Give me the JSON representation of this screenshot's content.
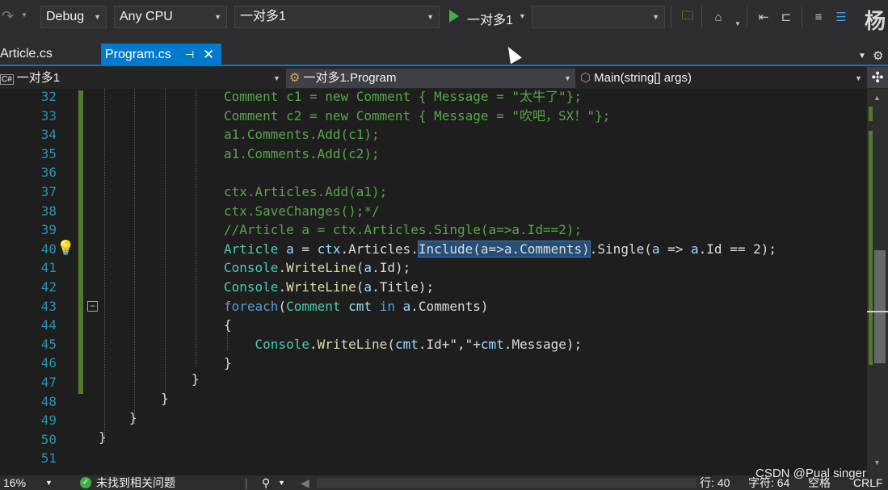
{
  "toolbar": {
    "config": "Debug",
    "platform": "Any CPU",
    "project": "一对多1",
    "run_target": "一对多1",
    "empty_dropdown": "",
    "right_char": "杨",
    "icons": [
      "undo-icon",
      "folder-search-icon",
      "home-icon",
      "step-icon",
      "breakpoint-icon",
      "align-icon",
      "comment-icon"
    ]
  },
  "tabs": [
    {
      "label": "Article.cs",
      "active": false
    },
    {
      "label": "Program.cs",
      "active": true
    }
  ],
  "navbar": {
    "project_icon": "C#",
    "project": "一对多1",
    "class": "一对多1.Program",
    "member": "Main(string[] args)"
  },
  "editor": {
    "line_numbers": [
      "32",
      "33",
      "34",
      "35",
      "36",
      "37",
      "38",
      "39",
      "40",
      "41",
      "42",
      "43",
      "44",
      "45",
      "46",
      "47",
      "48",
      "49",
      "50",
      "51"
    ],
    "lines": [
      [
        {
          "t": "Comment c1 = new Comment { Message = \"太牛了\"};",
          "c": "c-comment"
        }
      ],
      [
        {
          "t": "Comment c2 = new Comment { Message = \"吹吧，SX！\"};",
          "c": "c-comment"
        }
      ],
      [
        {
          "t": "a1.Comments.Add(c1);",
          "c": "c-comment"
        }
      ],
      [
        {
          "t": "a1.Comments.Add(c2);",
          "c": "c-comment"
        }
      ],
      [],
      [
        {
          "t": "ctx.Articles.Add(a1);",
          "c": "c-comment"
        }
      ],
      [
        {
          "t": "ctx.SaveChanges();*/",
          "c": "c-comment"
        }
      ],
      [
        {
          "t": "//Article a = ctx.Articles.Single(a=>a.Id==2);",
          "c": "c-comment"
        }
      ],
      [
        {
          "t": "Article",
          "c": "c-type"
        },
        {
          "t": " ",
          "c": "c-plain"
        },
        {
          "t": "a",
          "c": "c-id"
        },
        {
          "t": " = ",
          "c": "c-plain"
        },
        {
          "t": "ctx",
          "c": "c-id"
        },
        {
          "t": ".Articles.",
          "c": "c-plain"
        },
        {
          "t": "Include(a=>a.Comments)",
          "c": "sel c-plain"
        },
        {
          "t": ".Single(",
          "c": "c-plain"
        },
        {
          "t": "a",
          "c": "c-id"
        },
        {
          "t": " => ",
          "c": "c-plain"
        },
        {
          "t": "a",
          "c": "c-id"
        },
        {
          "t": ".Id == 2);",
          "c": "c-plain"
        }
      ],
      [
        {
          "t": "Console",
          "c": "c-type"
        },
        {
          "t": ".",
          "c": "c-plain"
        },
        {
          "t": "WriteLine",
          "c": "c-method"
        },
        {
          "t": "(",
          "c": "c-plain"
        },
        {
          "t": "a",
          "c": "c-id"
        },
        {
          "t": ".Id);",
          "c": "c-plain"
        }
      ],
      [
        {
          "t": "Console",
          "c": "c-type"
        },
        {
          "t": ".",
          "c": "c-plain"
        },
        {
          "t": "WriteLine",
          "c": "c-method"
        },
        {
          "t": "(",
          "c": "c-plain"
        },
        {
          "t": "a",
          "c": "c-id"
        },
        {
          "t": ".Title);",
          "c": "c-plain"
        }
      ],
      [
        {
          "t": "foreach",
          "c": "c-kw"
        },
        {
          "t": "(",
          "c": "c-plain"
        },
        {
          "t": "Comment",
          "c": "c-type"
        },
        {
          "t": " ",
          "c": "c-plain"
        },
        {
          "t": "cmt",
          "c": "c-id"
        },
        {
          "t": " in ",
          "c": "c-kw"
        },
        {
          "t": "a",
          "c": "c-id"
        },
        {
          "t": ".Comments)",
          "c": "c-plain"
        }
      ],
      [
        {
          "t": "{",
          "c": "c-plain"
        }
      ],
      [
        {
          "t": "    ",
          "c": "c-plain"
        },
        {
          "t": "Console",
          "c": "c-type"
        },
        {
          "t": ".",
          "c": "c-plain"
        },
        {
          "t": "WriteLine",
          "c": "c-method"
        },
        {
          "t": "(",
          "c": "c-plain"
        },
        {
          "t": "cmt",
          "c": "c-id"
        },
        {
          "t": ".Id+\",\"+",
          "c": "c-plain"
        },
        {
          "t": "cmt",
          "c": "c-id"
        },
        {
          "t": ".Message);",
          "c": "c-plain"
        }
      ],
      [
        {
          "t": "}",
          "c": "c-plain"
        }
      ],
      [],
      [],
      [],
      [],
      []
    ],
    "closing_braces": [
      "}",
      "}",
      "}",
      "}"
    ]
  },
  "statusbar": {
    "zoom": "16%",
    "issues": "未找到相关问题",
    "line": "行: 40",
    "char": "字符: 64",
    "whitespace": "空格",
    "line_ending": "CRLF"
  },
  "watermark": "CSDN @Pual singer"
}
